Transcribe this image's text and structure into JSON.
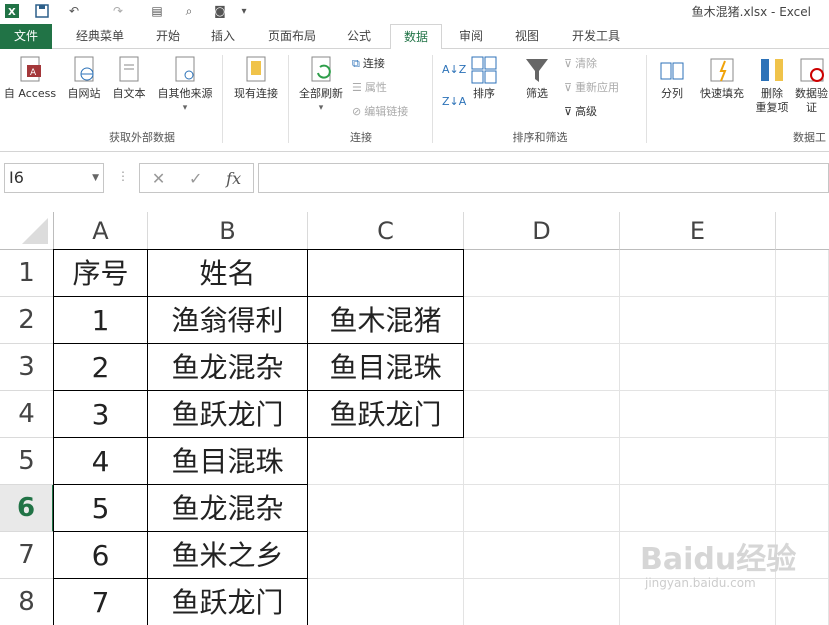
{
  "title": "鱼木混猪.xlsx - Excel",
  "quick_access": {
    "icons": [
      "excel-logo-icon",
      "save-icon",
      "undo-icon",
      "redo-icon",
      "form-icon",
      "print-preview-icon",
      "camera-icon",
      "customize-icon"
    ]
  },
  "tabs": [
    {
      "label": "文件"
    },
    {
      "label": "经典菜单"
    },
    {
      "label": "开始"
    },
    {
      "label": "插入"
    },
    {
      "label": "页面布局"
    },
    {
      "label": "公式"
    },
    {
      "label": "数据"
    },
    {
      "label": "审阅"
    },
    {
      "label": "视图"
    },
    {
      "label": "开发工具"
    }
  ],
  "active_tab": "数据",
  "ribbon": {
    "external": {
      "access": "自 Access",
      "web": "自网站",
      "text": "自文本",
      "other": "自其他来源",
      "existing": "现有连接",
      "group_label": "获取外部数据"
    },
    "connections": {
      "refresh_all": "全部刷新",
      "connections": "连接",
      "properties": "属性",
      "edit_links": "编辑链接",
      "group_label": "连接"
    },
    "sort_filter": {
      "sort": "排序",
      "filter": "筛选",
      "clear": "清除",
      "reapply": "重新应用",
      "advanced": "高级",
      "group_label": "排序和筛选"
    },
    "data_tools": {
      "text_to_columns": "分列",
      "flash_fill": "快速填充",
      "remove_duplicates_1": "删除",
      "remove_duplicates_2": "重复项",
      "validation_1": "数据验",
      "validation_2": "证",
      "group_label": "数据工"
    }
  },
  "formula_bar": {
    "name_box": "I6",
    "cancel": "✕",
    "enter": "✓",
    "fx": "fx",
    "formula": ""
  },
  "columns": [
    "A",
    "B",
    "C",
    "D",
    "E"
  ],
  "rows": [
    {
      "num": "1",
      "A": "序号",
      "B": "姓名",
      "C": ""
    },
    {
      "num": "2",
      "A": "1",
      "B": "渔翁得利",
      "C": "鱼木混猪"
    },
    {
      "num": "3",
      "A": "2",
      "B": "鱼龙混杂",
      "C": "鱼目混珠"
    },
    {
      "num": "4",
      "A": "3",
      "B": "鱼跃龙门",
      "C": "鱼跃龙门"
    },
    {
      "num": "5",
      "A": "4",
      "B": "鱼目混珠",
      "C": ""
    },
    {
      "num": "6",
      "A": "5",
      "B": "鱼龙混杂",
      "C": ""
    },
    {
      "num": "7",
      "A": "6",
      "B": "鱼米之乡",
      "C": ""
    },
    {
      "num": "8",
      "A": "7",
      "B": "鱼跃龙门",
      "C": ""
    }
  ],
  "selected_row": "6",
  "watermark": {
    "main": "Baidu经验",
    "sub": "jingyan.baidu.com"
  },
  "colors": {
    "accent": "#217346",
    "header_border": "#bcbcbc"
  }
}
